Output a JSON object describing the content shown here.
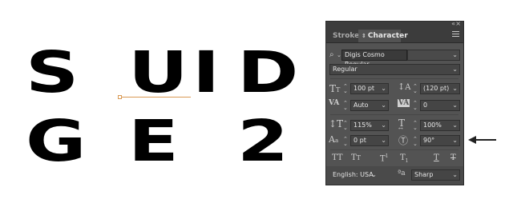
{
  "artboard": {
    "row1": [
      "S",
      "U",
      "I",
      "D"
    ],
    "row2": [
      "G",
      "E",
      "2"
    ]
  },
  "panel": {
    "tabs": [
      {
        "label": "Stroke",
        "active": false
      },
      {
        "label": "Character",
        "active": true
      }
    ],
    "font_family": "Digis Cosmo Regular",
    "font_style": "Regular",
    "font_size": "100 pt",
    "leading": "(120 pt)",
    "kerning": "Auto",
    "tracking": "0",
    "vertical_scale": "115%",
    "horizontal_scale": "100%",
    "baseline_shift": "0 pt",
    "character_rotation": "90°",
    "language": "English: USA",
    "antialiasing": "Sharp",
    "icons": {
      "search": "search-icon",
      "menu": "panel-menu-icon",
      "font_size": "font-size-icon",
      "leading": "leading-icon",
      "kerning": "kerning-icon",
      "tracking": "tracking-icon",
      "vertical_scale": "vertical-scale-icon",
      "horizontal_scale": "horizontal-scale-icon",
      "baseline_shift": "baseline-shift-icon",
      "rotation": "rotation-icon"
    },
    "colors": {
      "panel_bg": "#535353",
      "field_bg": "#454545",
      "text": "#dcdcdc"
    }
  }
}
